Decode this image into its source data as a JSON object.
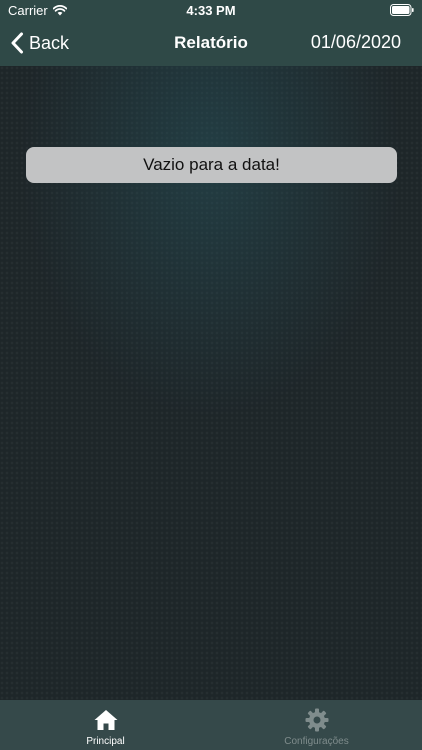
{
  "status_bar": {
    "carrier": "Carrier",
    "time": "4:33 PM"
  },
  "nav": {
    "back_label": "Back",
    "title": "Relatório",
    "date": "01/06/2020"
  },
  "content": {
    "empty_message": "Vazio para a data!"
  },
  "tab_bar": {
    "tabs": [
      {
        "label": "Principal",
        "icon": "home-icon",
        "active": true
      },
      {
        "label": "Configurações",
        "icon": "gear-icon",
        "active": false
      }
    ]
  },
  "colors": {
    "bar_background": "#2f4947",
    "tab_background": "#35494a",
    "message_background": "#c2c3c4"
  }
}
